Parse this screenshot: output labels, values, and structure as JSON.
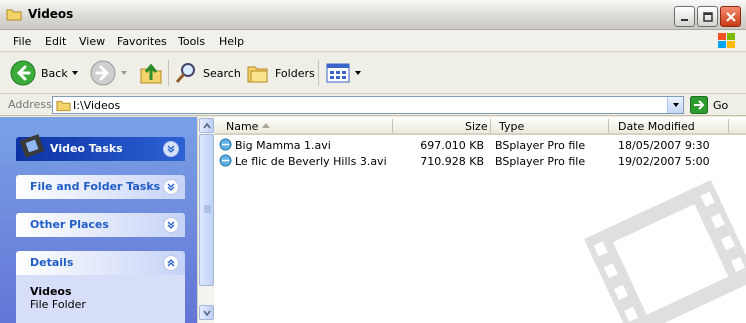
{
  "window": {
    "title": "Videos"
  },
  "menu": [
    "File",
    "Edit",
    "View",
    "Favorites",
    "Tools",
    "Help"
  ],
  "toolbar": {
    "back_label": "Back",
    "search_label": "Search",
    "folders_label": "Folders"
  },
  "address": {
    "label": "Address",
    "path": "I:\\Videos",
    "go_label": "Go"
  },
  "tasks": {
    "video_tasks": "Video Tasks",
    "file_folder_tasks": "File and Folder Tasks",
    "other_places": "Other Places",
    "details": "Details",
    "details_name": "Videos",
    "details_type": "File Folder"
  },
  "columns": {
    "name": "Name",
    "size": "Size",
    "type": "Type",
    "date_modified": "Date Modified"
  },
  "files": [
    {
      "name": "Big Mamma 1.avi",
      "size": "697.010 KB",
      "type": "BSplayer Pro file",
      "date": "18/05/2007 9:30"
    },
    {
      "name": "Le flic de Beverly Hills 3.avi",
      "size": "710.928 KB",
      "type": "BSplayer Pro file",
      "date": "19/02/2007 5:00"
    }
  ],
  "colors": {
    "task_bg": "#6f8ad9",
    "accent": "#215dc6",
    "header_dark": "#0c32a4"
  }
}
